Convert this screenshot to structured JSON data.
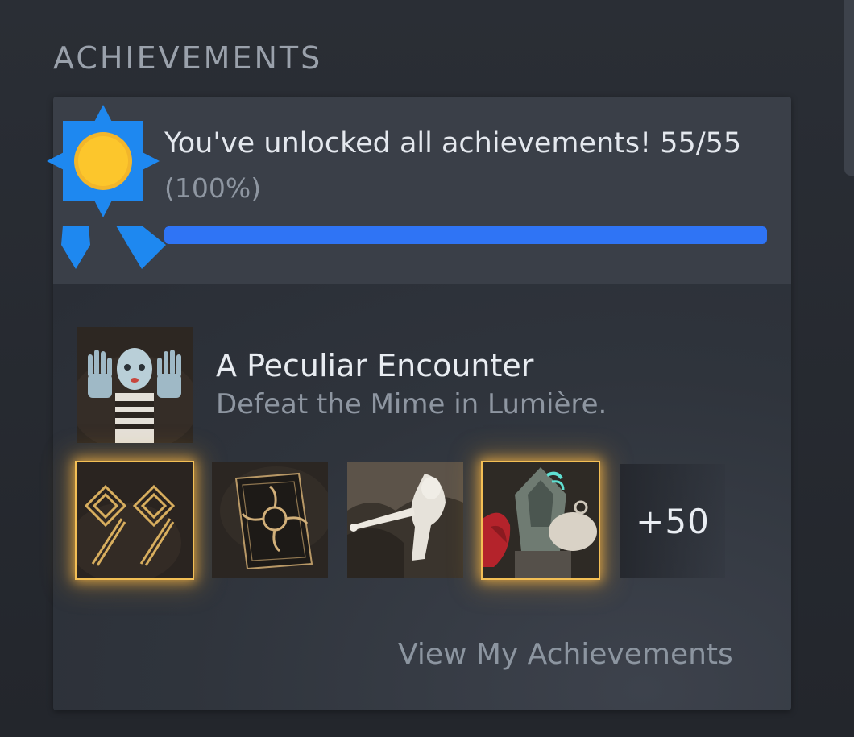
{
  "section": {
    "title": "ACHIEVEMENTS"
  },
  "summary": {
    "unlock_text": "You've unlocked all achievements! 55/55",
    "percent_text": "(100%)",
    "progress": 1.0,
    "progress_color": "#2f74f5",
    "badge_icon": "award-ribbon-icon"
  },
  "featured": {
    "name": "A Peculiar Encounter",
    "description": "Defeat the Mime in Lumière."
  },
  "tiles": [
    {
      "icon": "golden-diamond-sigil-icon",
      "highlighted": true
    },
    {
      "icon": "sun-moon-card-icon",
      "highlighted": false
    },
    {
      "icon": "archer-statue-icon",
      "highlighted": false
    },
    {
      "icon": "armored-guardian-icon",
      "highlighted": true
    }
  ],
  "more_count": "+50",
  "view_link": "View My Achievements",
  "colors": {
    "accent_blue": "#2f74f5",
    "badge_gold": "#fcc62c",
    "badge_blue": "#1e88f0",
    "glow_gold": "#f3bf55"
  }
}
